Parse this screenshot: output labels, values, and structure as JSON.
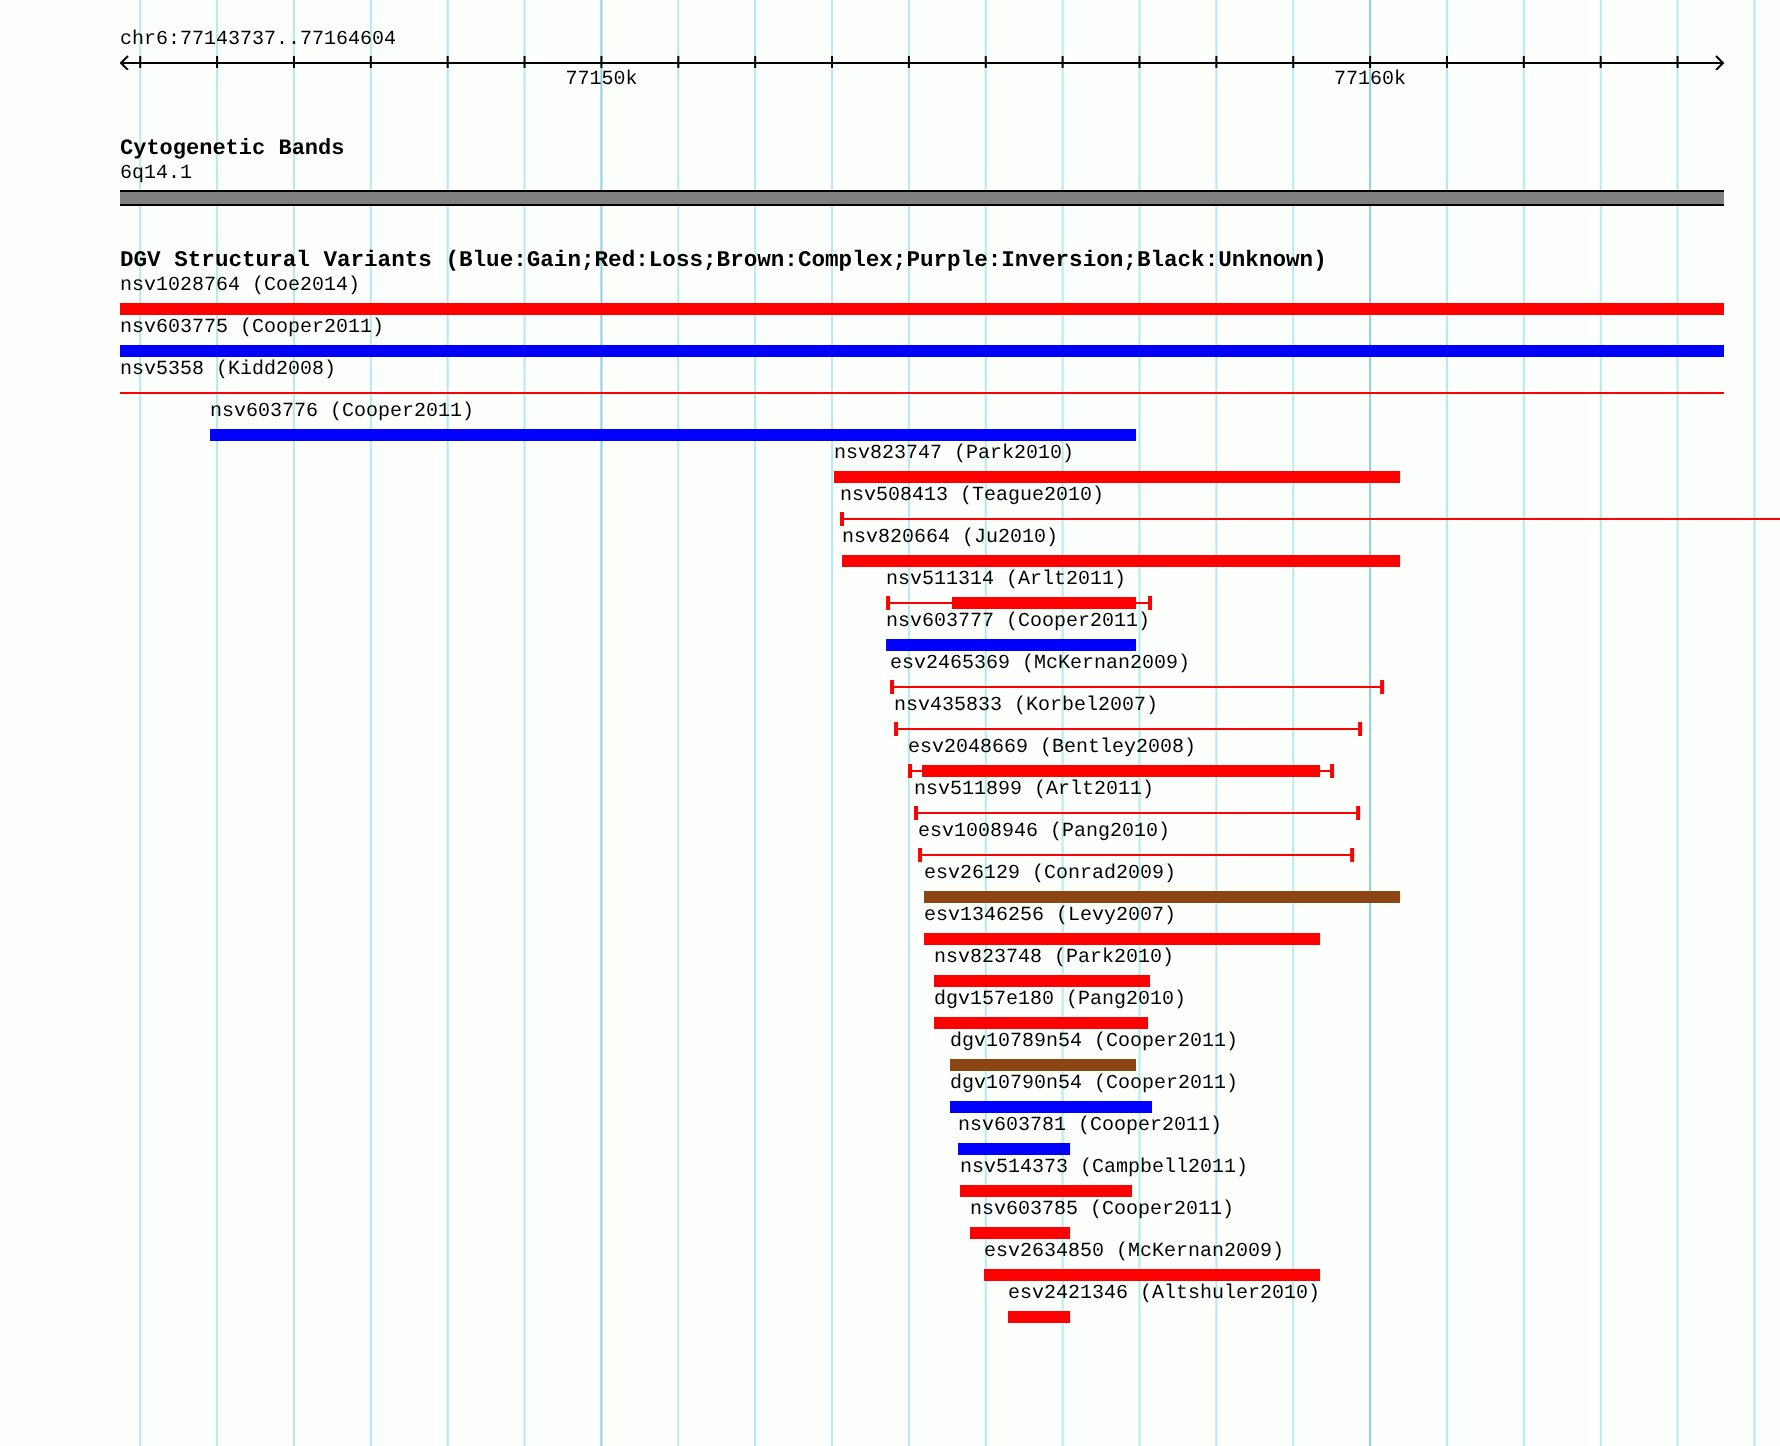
{
  "ruler": {
    "range": "chr6:77143737..77164604",
    "tick_labels": [
      "77150k",
      "77160k"
    ]
  },
  "cytoband_track": {
    "title": "Cytogenetic Bands",
    "band": "6q14.1"
  },
  "variant_track": {
    "title": "DGV Structural Variants (Blue:Gain;Red:Loss;Brown:Complex;Purple:Inversion;Black:Unknown)",
    "variants": [
      {
        "label": "nsv1028764 (Coe2014)",
        "kind": "thick",
        "color": "#ff0000"
      },
      {
        "label": "nsv603775 (Cooper2011)",
        "kind": "thick",
        "color": "#0000ff"
      },
      {
        "label": "nsv5358 (Kidd2008)",
        "kind": "line",
        "color": "#ff0000"
      },
      {
        "label": "nsv603776 (Cooper2011)",
        "kind": "thick",
        "color": "#0000ff"
      },
      {
        "label": "nsv823747 (Park2010)",
        "kind": "thick",
        "color": "#ff0000"
      },
      {
        "label": "nsv508413 (Teague2010)",
        "kind": "line",
        "color": "#ff0000"
      },
      {
        "label": "nsv820664 (Ju2010)",
        "kind": "thick",
        "color": "#ff0000"
      },
      {
        "label": "nsv511314 (Arlt2011)",
        "kind": "mixed",
        "color": "#ff0000"
      },
      {
        "label": "nsv603777 (Cooper2011)",
        "kind": "thick",
        "color": "#0000ff"
      },
      {
        "label": "esv2465369 (McKernan2009)",
        "kind": "line",
        "color": "#ff0000"
      },
      {
        "label": "nsv435833 (Korbel2007)",
        "kind": "line",
        "color": "#ff0000"
      },
      {
        "label": "esv2048669 (Bentley2008)",
        "kind": "mixed",
        "color": "#ff0000"
      },
      {
        "label": "nsv511899 (Arlt2011)",
        "kind": "line",
        "color": "#ff0000"
      },
      {
        "label": "esv1008946 (Pang2010)",
        "kind": "line",
        "color": "#ff0000"
      },
      {
        "label": "esv26129 (Conrad2009)",
        "kind": "thick",
        "color": "#8b4513"
      },
      {
        "label": "esv1346256 (Levy2007)",
        "kind": "thick",
        "color": "#ff0000"
      },
      {
        "label": "nsv823748 (Park2010)",
        "kind": "thick",
        "color": "#ff0000"
      },
      {
        "label": "dgv157e180 (Pang2010)",
        "kind": "thick",
        "color": "#ff0000"
      },
      {
        "label": "dgv10789n54 (Cooper2011)",
        "kind": "thick",
        "color": "#8b4513"
      },
      {
        "label": "dgv10790n54 (Cooper2011)",
        "kind": "thick",
        "color": "#0000ff"
      },
      {
        "label": "nsv603781 (Cooper2011)",
        "kind": "thick",
        "color": "#0000ff"
      },
      {
        "label": "nsv514373 (Campbell2011)",
        "kind": "thick",
        "color": "#ff0000"
      },
      {
        "label": "nsv603785 (Cooper2011)",
        "kind": "thick",
        "color": "#ff0000"
      },
      {
        "label": "esv2634850 (McKernan2009)",
        "kind": "thick",
        "color": "#ff0000"
      },
      {
        "label": "esv2421346 (Altshuler2010)",
        "kind": "thick",
        "color": "#ff0000"
      }
    ]
  }
}
